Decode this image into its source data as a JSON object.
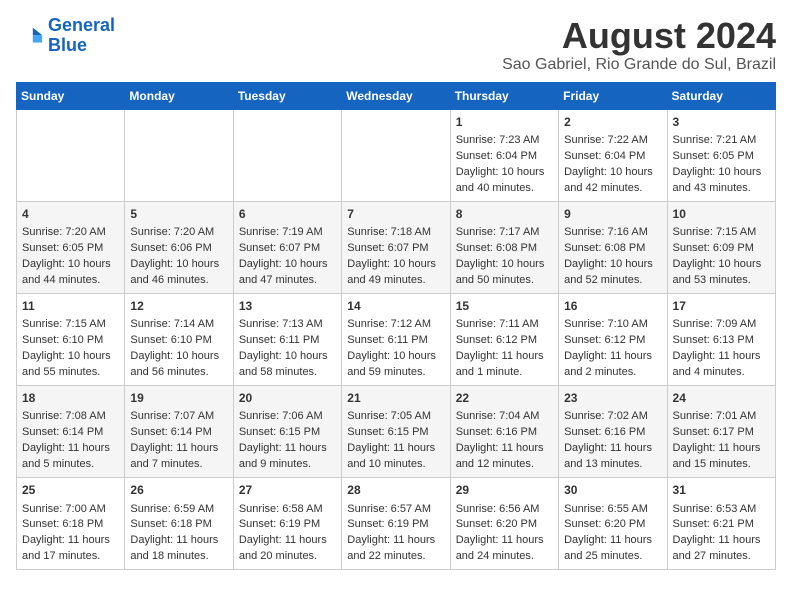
{
  "header": {
    "logo_line1": "General",
    "logo_line2": "Blue",
    "title": "August 2024",
    "subtitle": "Sao Gabriel, Rio Grande do Sul, Brazil"
  },
  "days_of_week": [
    "Sunday",
    "Monday",
    "Tuesday",
    "Wednesday",
    "Thursday",
    "Friday",
    "Saturday"
  ],
  "weeks": [
    [
      {
        "day": "",
        "info": ""
      },
      {
        "day": "",
        "info": ""
      },
      {
        "day": "",
        "info": ""
      },
      {
        "day": "",
        "info": ""
      },
      {
        "day": "1",
        "info": "Sunrise: 7:23 AM\nSunset: 6:04 PM\nDaylight: 10 hours\nand 40 minutes."
      },
      {
        "day": "2",
        "info": "Sunrise: 7:22 AM\nSunset: 6:04 PM\nDaylight: 10 hours\nand 42 minutes."
      },
      {
        "day": "3",
        "info": "Sunrise: 7:21 AM\nSunset: 6:05 PM\nDaylight: 10 hours\nand 43 minutes."
      }
    ],
    [
      {
        "day": "4",
        "info": "Sunrise: 7:20 AM\nSunset: 6:05 PM\nDaylight: 10 hours\nand 44 minutes."
      },
      {
        "day": "5",
        "info": "Sunrise: 7:20 AM\nSunset: 6:06 PM\nDaylight: 10 hours\nand 46 minutes."
      },
      {
        "day": "6",
        "info": "Sunrise: 7:19 AM\nSunset: 6:07 PM\nDaylight: 10 hours\nand 47 minutes."
      },
      {
        "day": "7",
        "info": "Sunrise: 7:18 AM\nSunset: 6:07 PM\nDaylight: 10 hours\nand 49 minutes."
      },
      {
        "day": "8",
        "info": "Sunrise: 7:17 AM\nSunset: 6:08 PM\nDaylight: 10 hours\nand 50 minutes."
      },
      {
        "day": "9",
        "info": "Sunrise: 7:16 AM\nSunset: 6:08 PM\nDaylight: 10 hours\nand 52 minutes."
      },
      {
        "day": "10",
        "info": "Sunrise: 7:15 AM\nSunset: 6:09 PM\nDaylight: 10 hours\nand 53 minutes."
      }
    ],
    [
      {
        "day": "11",
        "info": "Sunrise: 7:15 AM\nSunset: 6:10 PM\nDaylight: 10 hours\nand 55 minutes."
      },
      {
        "day": "12",
        "info": "Sunrise: 7:14 AM\nSunset: 6:10 PM\nDaylight: 10 hours\nand 56 minutes."
      },
      {
        "day": "13",
        "info": "Sunrise: 7:13 AM\nSunset: 6:11 PM\nDaylight: 10 hours\nand 58 minutes."
      },
      {
        "day": "14",
        "info": "Sunrise: 7:12 AM\nSunset: 6:11 PM\nDaylight: 10 hours\nand 59 minutes."
      },
      {
        "day": "15",
        "info": "Sunrise: 7:11 AM\nSunset: 6:12 PM\nDaylight: 11 hours\nand 1 minute."
      },
      {
        "day": "16",
        "info": "Sunrise: 7:10 AM\nSunset: 6:12 PM\nDaylight: 11 hours\nand 2 minutes."
      },
      {
        "day": "17",
        "info": "Sunrise: 7:09 AM\nSunset: 6:13 PM\nDaylight: 11 hours\nand 4 minutes."
      }
    ],
    [
      {
        "day": "18",
        "info": "Sunrise: 7:08 AM\nSunset: 6:14 PM\nDaylight: 11 hours\nand 5 minutes."
      },
      {
        "day": "19",
        "info": "Sunrise: 7:07 AM\nSunset: 6:14 PM\nDaylight: 11 hours\nand 7 minutes."
      },
      {
        "day": "20",
        "info": "Sunrise: 7:06 AM\nSunset: 6:15 PM\nDaylight: 11 hours\nand 9 minutes."
      },
      {
        "day": "21",
        "info": "Sunrise: 7:05 AM\nSunset: 6:15 PM\nDaylight: 11 hours\nand 10 minutes."
      },
      {
        "day": "22",
        "info": "Sunrise: 7:04 AM\nSunset: 6:16 PM\nDaylight: 11 hours\nand 12 minutes."
      },
      {
        "day": "23",
        "info": "Sunrise: 7:02 AM\nSunset: 6:16 PM\nDaylight: 11 hours\nand 13 minutes."
      },
      {
        "day": "24",
        "info": "Sunrise: 7:01 AM\nSunset: 6:17 PM\nDaylight: 11 hours\nand 15 minutes."
      }
    ],
    [
      {
        "day": "25",
        "info": "Sunrise: 7:00 AM\nSunset: 6:18 PM\nDaylight: 11 hours\nand 17 minutes."
      },
      {
        "day": "26",
        "info": "Sunrise: 6:59 AM\nSunset: 6:18 PM\nDaylight: 11 hours\nand 18 minutes."
      },
      {
        "day": "27",
        "info": "Sunrise: 6:58 AM\nSunset: 6:19 PM\nDaylight: 11 hours\nand 20 minutes."
      },
      {
        "day": "28",
        "info": "Sunrise: 6:57 AM\nSunset: 6:19 PM\nDaylight: 11 hours\nand 22 minutes."
      },
      {
        "day": "29",
        "info": "Sunrise: 6:56 AM\nSunset: 6:20 PM\nDaylight: 11 hours\nand 24 minutes."
      },
      {
        "day": "30",
        "info": "Sunrise: 6:55 AM\nSunset: 6:20 PM\nDaylight: 11 hours\nand 25 minutes."
      },
      {
        "day": "31",
        "info": "Sunrise: 6:53 AM\nSunset: 6:21 PM\nDaylight: 11 hours\nand 27 minutes."
      }
    ]
  ]
}
